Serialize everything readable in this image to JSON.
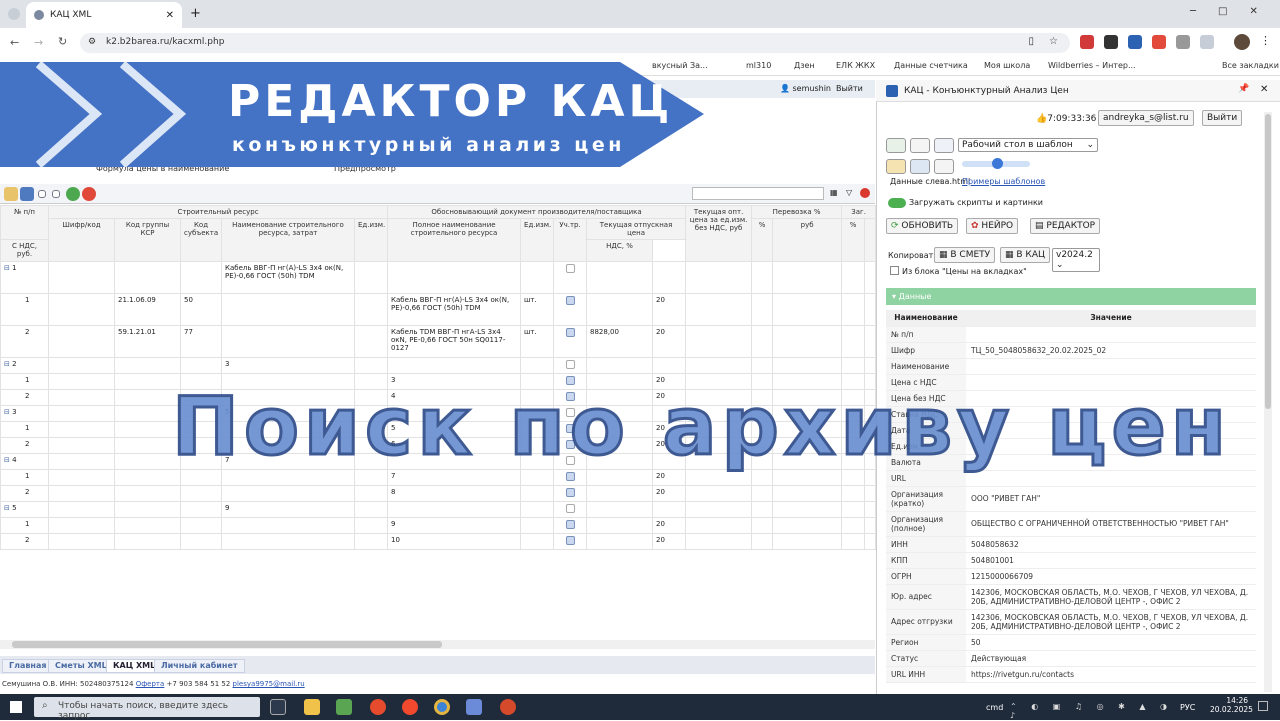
{
  "browser": {
    "tab_title": "КАЦ XML",
    "url": "k2.b2barea.ru/kacxml.php",
    "bookmarks": [
      "вкусный За...",
      "ml310",
      "Дзен",
      "ЕЛК ЖКХ",
      "Данные счетчика",
      "Моя школа",
      "Wildberries – Интер...",
      "Все закладки"
    ]
  },
  "banner": {
    "title": "РЕДАКТОР КАЦ",
    "subtitle": "конъюнктурный анализ цен"
  },
  "app": {
    "user": "semushin",
    "logout": "Выйти",
    "formula_tab": "Формула цены в наименование",
    "preview_tab": "Предпросмотр",
    "overlay": "Поиск по архиву цен",
    "headers": {
      "num": "№ п/п",
      "resource": "Строительный ресурс",
      "code": "Шифр/код",
      "ksr": "Код группы КСР",
      "subject": "Код субъекта",
      "res_name": "Наименование строительного ресурса, затрат",
      "unit": "Ед.изм.",
      "doc": "Обосновывающий документ производителя/поставщика",
      "full_name": "Полное наименование строительного ресурса",
      "doc_unit": "Ед.изм.",
      "uch": "Уч.тр.",
      "price": "Текущая отпускная цена",
      "with_vat": "С НДС, руб.",
      "vat": "НДС, %",
      "opt": "Текущая опт. цена за ед.изм. без НДС, руб",
      "transport": "Перевозка %",
      "pct": "%",
      "rub": "руб",
      "zag": "Заг.",
      "pct2": "%"
    },
    "rows": [
      {
        "num": "1",
        "code": "",
        "ksr": "",
        "subj": "",
        "name": "Кабель ВВГ-П нг(А)-LS 3х4 ок(N, PE)-0,66 ГОСТ (50h) TDM",
        "unit": "",
        "full": "",
        "dunit": "",
        "uch": false,
        "price": "",
        "vat": "",
        "group": true
      },
      {
        "num": "1",
        "code": "",
        "ksr": "21.1.06.09",
        "subj": "50",
        "name": "",
        "unit": "",
        "full": "Кабель ВВГ-П нг(А)-LS 3х4 ок(N, PE)-0,66 ГОСТ (50h) TDM",
        "dunit": "шт.",
        "uch": true,
        "price": "",
        "vat": "20",
        "group": false
      },
      {
        "num": "2",
        "code": "",
        "ksr": "59.1.21.01",
        "subj": "77",
        "name": "",
        "unit": "",
        "full": "Кабель TDM ВВГ-П нгА-LS 3х4 окN, PE-0,66 ГОСТ 50н SQ0117-0127",
        "dunit": "шт.",
        "uch": true,
        "price": "8828,00",
        "vat": "20",
        "group": false
      },
      {
        "num": "2",
        "code": "",
        "ksr": "",
        "subj": "",
        "name": "3",
        "unit": "",
        "full": "",
        "dunit": "",
        "uch": false,
        "price": "",
        "vat": "",
        "group": true
      },
      {
        "num": "1",
        "code": "",
        "ksr": "",
        "subj": "",
        "name": "",
        "unit": "",
        "full": "3",
        "dunit": "",
        "uch": true,
        "price": "",
        "vat": "20",
        "group": false
      },
      {
        "num": "2",
        "code": "",
        "ksr": "",
        "subj": "",
        "name": "",
        "unit": "",
        "full": "4",
        "dunit": "",
        "uch": true,
        "price": "",
        "vat": "20",
        "group": false
      },
      {
        "num": "3",
        "code": "",
        "ksr": "",
        "subj": "",
        "name": "5",
        "unit": "",
        "full": "",
        "dunit": "",
        "uch": false,
        "price": "",
        "vat": "",
        "group": true
      },
      {
        "num": "1",
        "code": "",
        "ksr": "",
        "subj": "",
        "name": "",
        "unit": "",
        "full": "5",
        "dunit": "",
        "uch": true,
        "price": "",
        "vat": "20",
        "group": false
      },
      {
        "num": "2",
        "code": "",
        "ksr": "",
        "subj": "",
        "name": "",
        "unit": "",
        "full": "6",
        "dunit": "",
        "uch": true,
        "price": "",
        "vat": "20",
        "group": false
      },
      {
        "num": "4",
        "code": "",
        "ksr": "",
        "subj": "",
        "name": "7",
        "unit": "",
        "full": "",
        "dunit": "",
        "uch": false,
        "price": "",
        "vat": "",
        "group": true
      },
      {
        "num": "1",
        "code": "",
        "ksr": "",
        "subj": "",
        "name": "",
        "unit": "",
        "full": "7",
        "dunit": "",
        "uch": true,
        "price": "",
        "vat": "20",
        "group": false
      },
      {
        "num": "2",
        "code": "",
        "ksr": "",
        "subj": "",
        "name": "",
        "unit": "",
        "full": "8",
        "dunit": "",
        "uch": true,
        "price": "",
        "vat": "20",
        "group": false
      },
      {
        "num": "5",
        "code": "",
        "ksr": "",
        "subj": "",
        "name": "9",
        "unit": "",
        "full": "",
        "dunit": "",
        "uch": false,
        "price": "",
        "vat": "",
        "group": true
      },
      {
        "num": "1",
        "code": "",
        "ksr": "",
        "subj": "",
        "name": "",
        "unit": "",
        "full": "9",
        "dunit": "",
        "uch": true,
        "price": "",
        "vat": "20",
        "group": false
      },
      {
        "num": "2",
        "code": "",
        "ksr": "",
        "subj": "",
        "name": "",
        "unit": "",
        "full": "10",
        "dunit": "",
        "uch": true,
        "price": "",
        "vat": "20",
        "group": false
      }
    ],
    "bottom_tabs": [
      "Главная",
      "Сметы XML",
      "КАЦ XML",
      "Личный кабинет"
    ],
    "status_prefix": "Семушина О.В. ИНН: 502480375124",
    "status_offer": "Оферта",
    "status_phone": "+7 903 584 51 52",
    "status_email": "plesya9975@mail.ru"
  },
  "panel": {
    "title": "КАЦ - Конъюнктурный Анализ Цен",
    "time": "7:09:33:36",
    "email": "andreyka_s@list.ru",
    "logout": "Выйти",
    "template_select": "Рабочий стол в шаблон",
    "data_left": "Данные слева.html",
    "examples": "Примеры шаблонов",
    "load_scripts": "Загружать скрипты и картинки",
    "btn_update": "ОБНОВИТЬ",
    "btn_neuro": "НЕЙРО",
    "btn_editor": "РЕДАКТОР",
    "copy_label": "Копировать:",
    "btn_to_smeta": "В СМЕТУ",
    "btn_to_kac": "В КАЦ",
    "version": "v2024.2",
    "from_block": "Из блока \"Цены на вкладках\"",
    "section": "Данные",
    "col_name": "Наименование",
    "col_value": "Значение",
    "fields": [
      {
        "k": "№ п/п",
        "v": ""
      },
      {
        "k": "Шифр",
        "v": "ТЦ_50_5048058632_20.02.2025_02"
      },
      {
        "k": "Наименование",
        "v": ""
      },
      {
        "k": "Цена с НДС",
        "v": ""
      },
      {
        "k": "Цена без НДС",
        "v": ""
      },
      {
        "k": "Ставка НДС",
        "v": ""
      },
      {
        "k": "Дата",
        "v": ""
      },
      {
        "k": "Ед.изм.",
        "v": ""
      },
      {
        "k": "Валюта",
        "v": ""
      },
      {
        "k": "URL",
        "v": ""
      },
      {
        "k": "Организация (кратко)",
        "v": "ООО \"РИВЕТ ГАН\""
      },
      {
        "k": "Организация (полное)",
        "v": "ОБЩЕСТВО С ОГРАНИЧЕННОЙ ОТВЕТСТВЕННОСТЬЮ \"РИВЕТ ГАН\""
      },
      {
        "k": "ИНН",
        "v": "5048058632"
      },
      {
        "k": "КПП",
        "v": "504801001"
      },
      {
        "k": "ОГРН",
        "v": "1215000066709"
      },
      {
        "k": "Юр. адрес",
        "v": "142306, МОСКОВСКАЯ ОБЛАСТЬ, М.О. ЧЕХОВ, Г ЧЕХОВ, УЛ ЧЕХОВА, Д. 20Б, АДМИНИСТРАТИВНО-ДЕЛОВОЙ ЦЕНТР -, ОФИС 2"
      },
      {
        "k": "Адрес отгрузки",
        "v": "142306, МОСКОВСКАЯ ОБЛАСТЬ, М.О. ЧЕХОВ, Г ЧЕХОВ, УЛ ЧЕХОВА, Д. 20Б, АДМИНИСТРАТИВНО-ДЕЛОВОЙ ЦЕНТР -, ОФИС 2"
      },
      {
        "k": "Регион",
        "v": "50"
      },
      {
        "k": "Статус",
        "v": "Действующая"
      },
      {
        "k": "URL ИНН",
        "v": "https://rivetgun.ru/contacts"
      }
    ]
  },
  "taskbar": {
    "search_placeholder": "Чтобы начать поиск, введите здесь запрос",
    "cmd": "cmd",
    "lang": "РУС",
    "time": "14:26",
    "date": "20.02.2025"
  }
}
